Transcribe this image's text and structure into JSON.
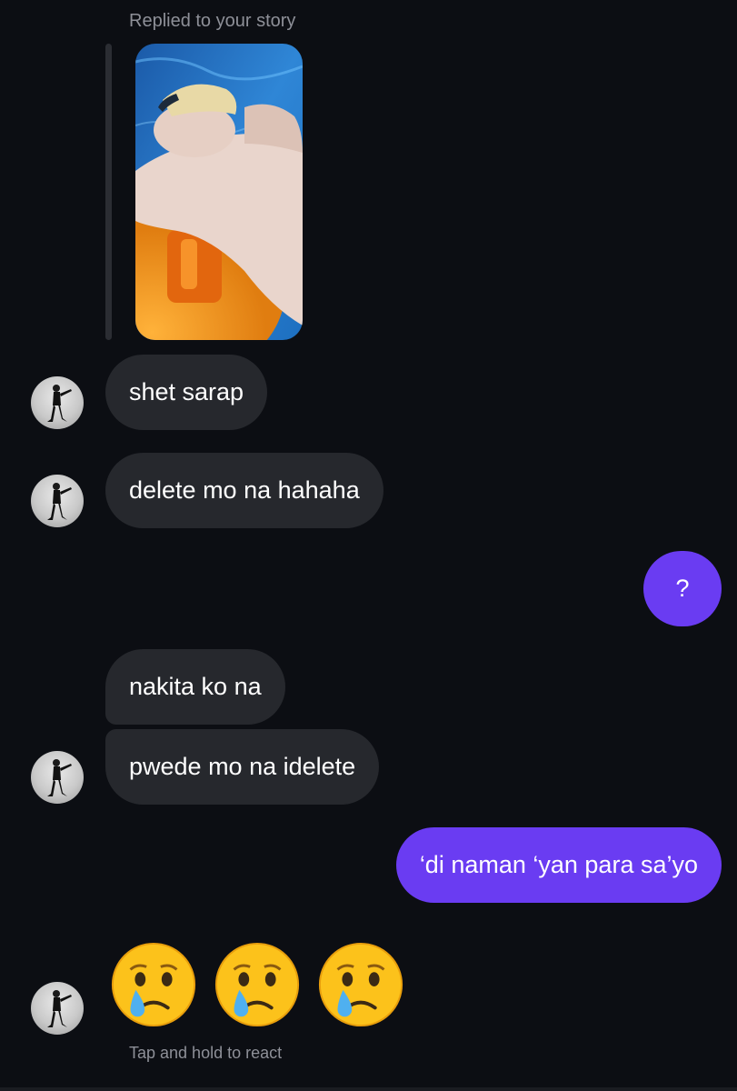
{
  "story_reply": {
    "label": "Replied to your story"
  },
  "messages": [
    {
      "sender": "them",
      "text": "shet sarap"
    },
    {
      "sender": "them",
      "text": "delete mo na hahaha"
    },
    {
      "sender": "me",
      "text": "?"
    },
    {
      "sender": "them",
      "text": "nakita ko na"
    },
    {
      "sender": "them",
      "text": "pwede mo na idelete"
    },
    {
      "sender": "me",
      "text": "‘di naman ‘yan para sa’yo"
    },
    {
      "sender": "them",
      "emoji": "crying-face",
      "count": 3
    }
  ],
  "reaction_hint": "Tap and hold to react",
  "colors": {
    "background": "#0c0e13",
    "incoming_bubble": "#26282d",
    "outgoing_bubble": "#6a3cf2",
    "secondary_text": "#8e9098"
  }
}
